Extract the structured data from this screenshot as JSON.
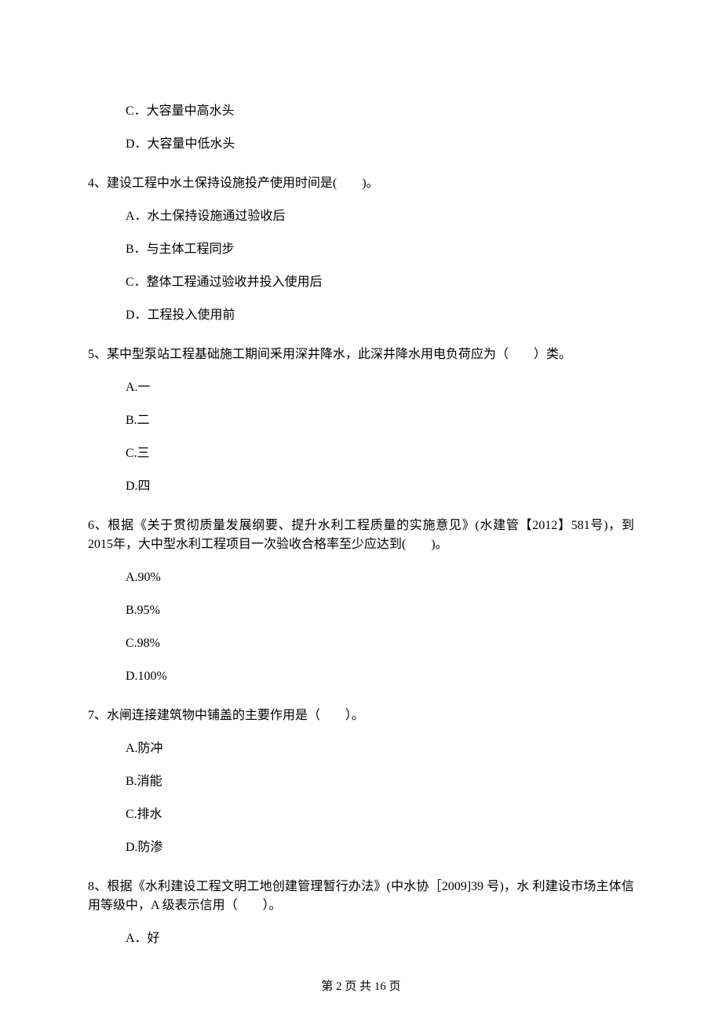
{
  "q3_tail": {
    "optC": "C．大容量中高水头",
    "optD": "D．大容量中低水头"
  },
  "q4": {
    "stem": "4、建设工程中水土保持设施投产使用时间是(　　)。",
    "optA": "A．水土保持设施通过验收后",
    "optB": "B．与主体工程同步",
    "optC": "C．整体工程通过验收并投入使用后",
    "optD": "D．工程投入使用前"
  },
  "q5": {
    "stem": "5、某中型泵站工程基础施工期间釆用深井降水，此深井降水用电负荷应为（　　）类。",
    "optA": "A.一",
    "optB": "B.二",
    "optC": "C.三",
    "optD": "D.四"
  },
  "q6": {
    "stem": "6、根据《关于贯彻质量发展纲要、提升水利工程质量的实施意见》(水建管【2012】581号)，到2015年，大中型水利工程项目一次验收合格率至少应达到(　　)。",
    "optA": "A.90%",
    "optB": "B.95%",
    "optC": "C.98%",
    "optD": "D.100%"
  },
  "q7": {
    "stem": "7、水闸连接建筑物中铺盖的主要作用是（　　）。",
    "optA": "A.防冲",
    "optB": "B.消能",
    "optC": "C.排水",
    "optD": "D.防渗"
  },
  "q8": {
    "stem": "8、根据《水利建设工程文明工地创建管理暂行办法》(中水协［2009]39 号)，水 利建设市场主体信用等级中，A 级表示信用（　　）。",
    "optA": "A．好"
  },
  "footer": "第 2 页 共 16 页"
}
